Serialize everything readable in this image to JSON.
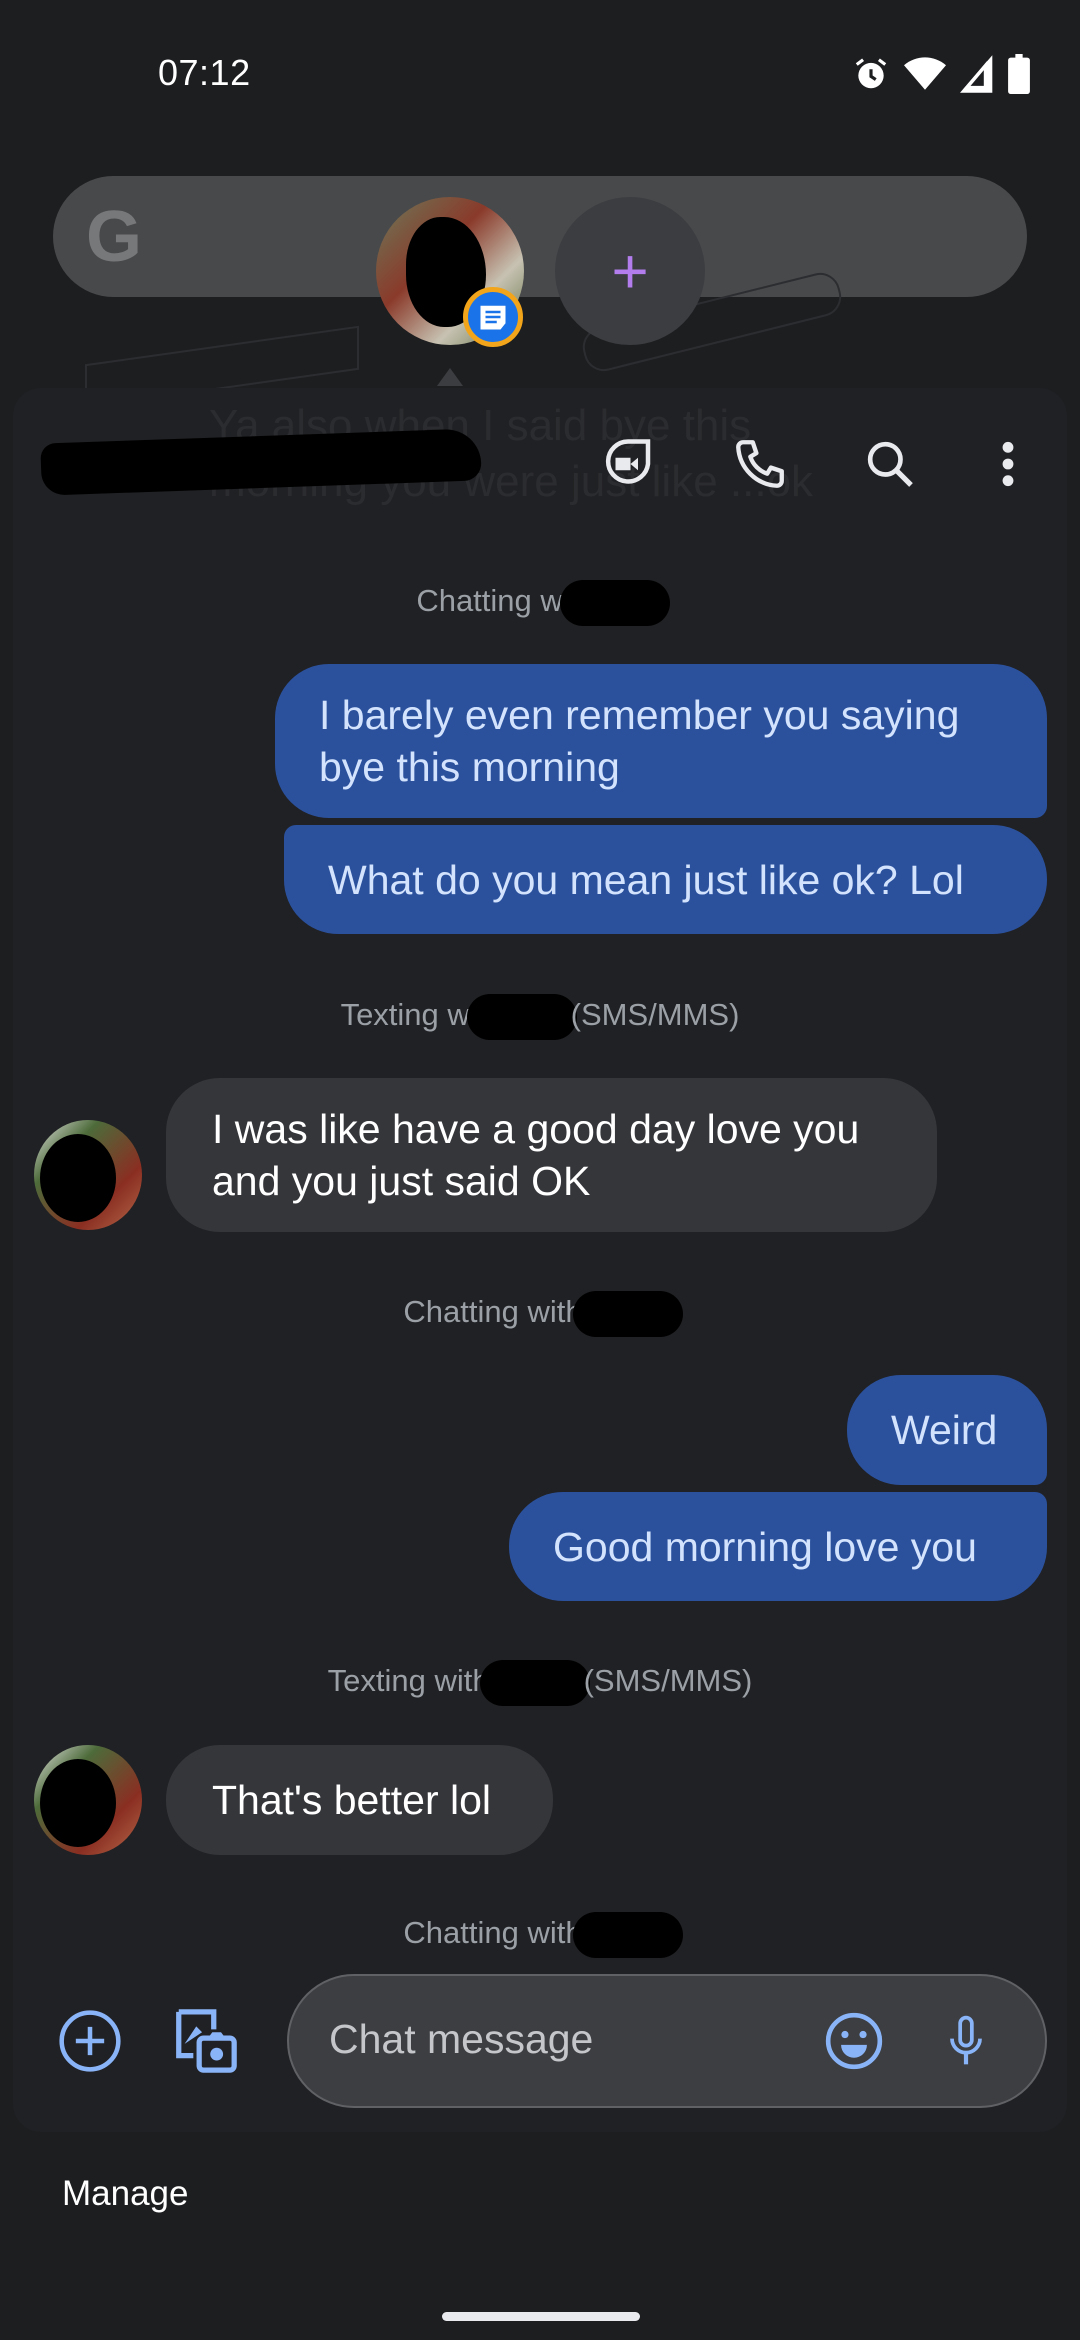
{
  "status_bar": {
    "time": "07:12",
    "icons": [
      "alarm-icon",
      "wifi-icon",
      "cellular-signal-icon",
      "battery-icon"
    ]
  },
  "home_screen": {
    "search_logo": "G",
    "add_bubble_label": "+"
  },
  "chat_header": {
    "contact_name": "[redacted]",
    "ghost_preview_text": "Ya also when I said bye this morning you were just like ...ok",
    "actions": [
      {
        "name": "video-call",
        "icon": "duo-video-icon"
      },
      {
        "name": "voice-call",
        "icon": "phone-icon"
      },
      {
        "name": "search",
        "icon": "search-icon"
      },
      {
        "name": "more-options",
        "icon": "more-vert-icon"
      }
    ]
  },
  "messages": [
    {
      "type": "system",
      "prefix": "Chatting wi",
      "suffix": ""
    },
    {
      "type": "outgoing",
      "text": "I barely even remember you saying bye this morning"
    },
    {
      "type": "outgoing",
      "text": "What do you mean just like ok? Lol"
    },
    {
      "type": "system",
      "prefix": "Texting wi",
      "suffix": "(SMS/MMS)"
    },
    {
      "type": "incoming",
      "text": "I was like have a good day love you and you just said OK"
    },
    {
      "type": "system",
      "prefix": "Chatting with",
      "suffix": ""
    },
    {
      "type": "outgoing",
      "text": "Weird"
    },
    {
      "type": "outgoing",
      "text": "Good morning love you"
    },
    {
      "type": "system",
      "prefix": "Texting with",
      "suffix": "(SMS/MMS)"
    },
    {
      "type": "incoming",
      "text": "That's better lol"
    },
    {
      "type": "system",
      "prefix": "Chatting with",
      "suffix": ""
    }
  ],
  "compose": {
    "placeholder": "Chat message",
    "value": "",
    "accent_color": "#8ab4f8"
  },
  "footer": {
    "manage_label": "Manage"
  },
  "colors": {
    "outgoing_bubble": "#2b519d",
    "outgoing_text": "#d3e3fd",
    "incoming_bubble": "#35363a",
    "background": "#202124"
  }
}
